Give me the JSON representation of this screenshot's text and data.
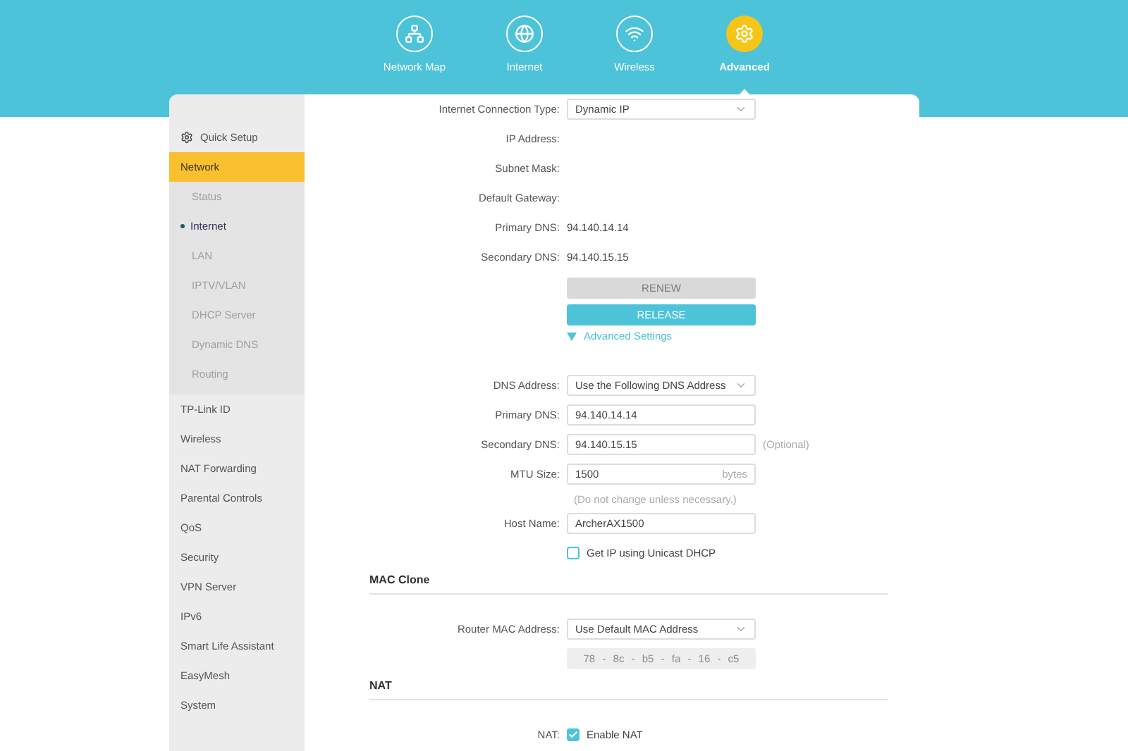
{
  "nav": [
    {
      "label": "Network Map",
      "selected": false
    },
    {
      "label": "Internet",
      "selected": false
    },
    {
      "label": "Wireless",
      "selected": false
    },
    {
      "label": "Advanced",
      "selected": true
    }
  ],
  "sidebar": {
    "quick_setup": "Quick Setup",
    "items": [
      {
        "label": "Network",
        "selected": true,
        "children": [
          {
            "label": "Status",
            "selected": false
          },
          {
            "label": "Internet",
            "selected": true
          },
          {
            "label": "LAN",
            "selected": false
          },
          {
            "label": "IPTV/VLAN",
            "selected": false
          },
          {
            "label": "DHCP Server",
            "selected": false
          },
          {
            "label": "Dynamic DNS",
            "selected": false
          },
          {
            "label": "Routing",
            "selected": false
          }
        ]
      },
      {
        "label": "TP-Link ID",
        "selected": false
      },
      {
        "label": "Wireless",
        "selected": false
      },
      {
        "label": "NAT Forwarding",
        "selected": false
      },
      {
        "label": "Parental Controls",
        "selected": false
      },
      {
        "label": "QoS",
        "selected": false
      },
      {
        "label": "Security",
        "selected": false
      },
      {
        "label": "VPN Server",
        "selected": false
      },
      {
        "label": "IPv6",
        "selected": false
      },
      {
        "label": "Smart Life Assistant",
        "selected": false
      },
      {
        "label": "EasyMesh",
        "selected": false
      },
      {
        "label": "System",
        "selected": false
      }
    ]
  },
  "status_rows": [
    {
      "kind": "select",
      "label": "Internet Connection Type:",
      "value": "Dynamic IP"
    },
    {
      "kind": "text",
      "label": "IP Address:"
    },
    {
      "kind": "text",
      "label": "Subnet Mask:"
    },
    {
      "kind": "text",
      "label": "Default Gateway:"
    },
    {
      "kind": "text",
      "label": "Primary DNS:",
      "value": "94.140.14.14"
    },
    {
      "kind": "text",
      "label": "Secondary DNS:",
      "value": "94.140.15.15"
    }
  ],
  "buttons": [
    {
      "label": "RENEW",
      "disabled": true
    },
    {
      "label": "RELEASE",
      "disabled": false
    }
  ],
  "advanced_toggle": {
    "label": "Advanced Settings",
    "expanded": true
  },
  "advanced_fields": [
    {
      "kind": "select",
      "label": "DNS Address:",
      "value": "Use the Following DNS Address"
    },
    {
      "kind": "input",
      "label": "Primary DNS:",
      "value": "94.140.14.14"
    },
    {
      "kind": "input",
      "label": "Secondary DNS:",
      "value": "94.140.15.15",
      "note": "(Optional)"
    },
    {
      "kind": "input",
      "label": "MTU Size:",
      "value": "1500",
      "suffix": "bytes",
      "hint": "(Do not change unless necessary.)"
    },
    {
      "kind": "input",
      "label": "Host Name:",
      "value": "ArcherAX1500"
    },
    {
      "kind": "checkbox",
      "text": "Get IP using Unicast DHCP",
      "checked": false
    }
  ],
  "sections": [
    {
      "title": "MAC Clone",
      "fields": [
        {
          "kind": "select",
          "label": "Router MAC Address:",
          "value": "Use Default MAC Address"
        },
        {
          "kind": "mac",
          "value": "78 - 8c - b5 - fa - 16 - c5",
          "disabled": true
        }
      ]
    },
    {
      "title": "NAT",
      "fields": [
        {
          "kind": "checkbox",
          "label": "NAT:",
          "text": "Enable NAT",
          "checked": true
        }
      ]
    }
  ]
}
